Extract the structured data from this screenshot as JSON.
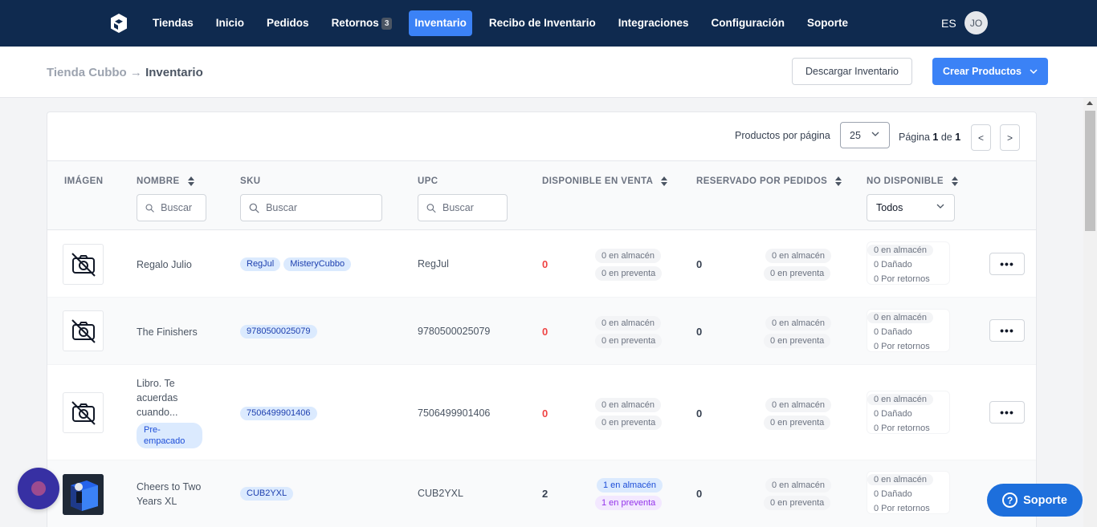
{
  "nav": {
    "items": [
      {
        "label": "Tiendas",
        "active": false
      },
      {
        "label": "Inicio",
        "active": false
      },
      {
        "label": "Pedidos",
        "active": false
      },
      {
        "label": "Retornos",
        "active": false,
        "badge": "3"
      },
      {
        "label": "Inventario",
        "active": true
      },
      {
        "label": "Recibo de Inventario",
        "active": false
      },
      {
        "label": "Integraciones",
        "active": false
      },
      {
        "label": "Configuración",
        "active": false
      },
      {
        "label": "Soporte",
        "active": false
      }
    ],
    "lang": "ES",
    "avatar": "JO"
  },
  "header": {
    "breadcrumb_store": "Tienda Cubbo",
    "breadcrumb_arrow": "→",
    "breadcrumb_page": "Inventario",
    "download_label": "Descargar Inventario",
    "create_label": "Crear Productos"
  },
  "pager": {
    "per_page_label": "Productos por página",
    "per_page_value": "25",
    "page_prefix": "Página",
    "page_current": "1",
    "page_of": "de",
    "page_total": "1",
    "prev": "<",
    "next": ">"
  },
  "table": {
    "headers": {
      "image": "IMÁGEN",
      "name": "NOMBRE",
      "sku": "SKU",
      "upc": "UPC",
      "available": "DISPONIBLE EN VENTA",
      "reserved": "RESERVADO POR PEDIDOS",
      "unavailable": "NO DISPONIBLE"
    },
    "search_placeholder": "Buscar",
    "unavailable_filter": "Todos",
    "rows": [
      {
        "name": "Regalo Julio",
        "tag": "",
        "skus": [
          "RegJul",
          "MisteryCubbo"
        ],
        "upc": "RegJul",
        "available": "0",
        "avail_stock": "0 en almacén",
        "avail_pre": "0 en preventa",
        "reserved": "0",
        "res_stock": "0 en almacén",
        "res_pre": "0 en preventa",
        "un_stock": "0 en almacén",
        "un_damaged": "0 Dañado",
        "un_returns": "0 Por retornos",
        "more": "•••"
      },
      {
        "name": "The Finishers",
        "tag": "",
        "skus": [
          "9780500025079"
        ],
        "upc": "9780500025079",
        "available": "0",
        "avail_stock": "0 en almacén",
        "avail_pre": "0 en preventa",
        "reserved": "0",
        "res_stock": "0 en almacén",
        "res_pre": "0 en preventa",
        "un_stock": "0 en almacén",
        "un_damaged": "0 Dañado",
        "un_returns": "0 Por retornos",
        "more": "•••"
      },
      {
        "name": "Libro. Te acuerdas cuando...",
        "tag": "Pre-empacado",
        "skus": [
          "7506499901406"
        ],
        "upc": "7506499901406",
        "available": "0",
        "avail_stock": "0 en almacén",
        "avail_pre": "0 en preventa",
        "reserved": "0",
        "res_stock": "0 en almacén",
        "res_pre": "0 en preventa",
        "un_stock": "0 en almacén",
        "un_damaged": "0 Dañado",
        "un_returns": "0 Por retornos",
        "more": "•••"
      },
      {
        "name": "Cheers to Two Years XL",
        "tag": "",
        "skus": [
          "CUB2YXL"
        ],
        "upc": "CUB2YXL",
        "available": "2",
        "avail_stock": "1 en almacén",
        "avail_pre": "1 en preventa",
        "reserved": "0",
        "res_stock": "0 en almacén",
        "res_pre": "0 en preventa",
        "un_stock": "0 en almacén",
        "un_damaged": "0 Dañado",
        "un_returns": "0 Por retornos",
        "more": "•••"
      }
    ]
  },
  "support_label": "Soporte",
  "colors": {
    "nav_bg": "#0f2a4f",
    "accent": "#3b82f6",
    "danger": "#ef4444"
  }
}
